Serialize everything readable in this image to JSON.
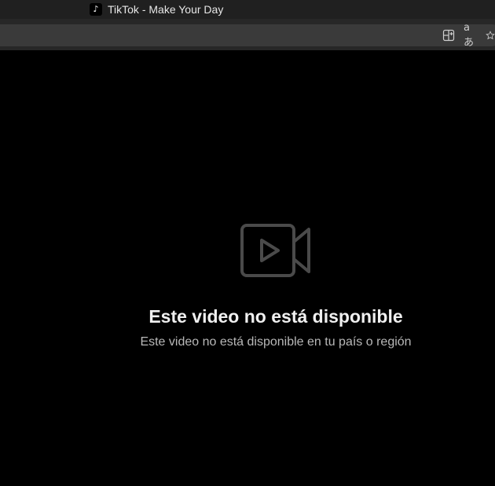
{
  "browser": {
    "tab_title": "TikTok - Make Your Day",
    "favicon_glyph": "♪",
    "toolbar_icons": [
      "split-screen-icon",
      "translate-icon",
      "favorite-star-icon"
    ],
    "translate_glyph": "aあ"
  },
  "main": {
    "icon": "video-unavailable-icon",
    "title": "Este video no está disponible",
    "subtitle": "Este video no está disponible en tu país o región"
  },
  "colors": {
    "background": "#000000",
    "title_text": "#f0f0f0",
    "subtitle_text": "#b8b8b8",
    "icon_stroke": "#4a4a4a"
  }
}
